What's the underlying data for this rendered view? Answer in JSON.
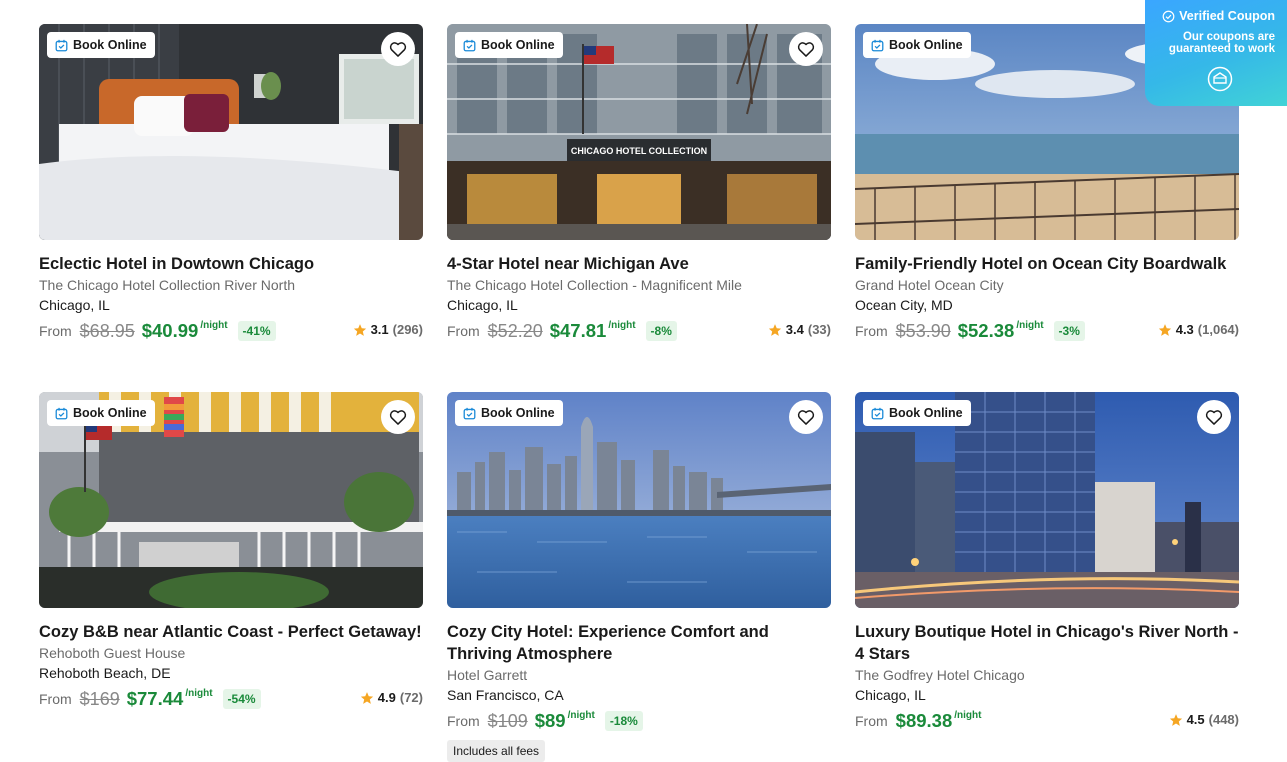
{
  "coupon": {
    "title": "Verified Coupon",
    "subtitle_line1": "Our coupons are",
    "subtitle_line2": "guaranteed to work"
  },
  "labels": {
    "book_online": "Book Online",
    "from": "From",
    "per_night": "/night",
    "includes_fees": "Includes all fees"
  },
  "colors": {
    "price_green": "#1a8a3a",
    "discount_bg": "#e5f5e8",
    "star": "#f5a623",
    "coupon_gradient_start": "#3aa6ff"
  },
  "listings": [
    {
      "title": "Eclectic Hotel in Dowtown Chicago",
      "hotel": "The Chicago Hotel Collection River North",
      "city": "Chicago, IL",
      "old_price": "$68.95",
      "new_price": "$40.99",
      "discount": "-41%",
      "rating": "3.1",
      "reviews": "(296)",
      "image_icon": "hotel-bedroom-image"
    },
    {
      "title": "4-Star Hotel near Michigan Ave",
      "hotel": "The Chicago Hotel Collection - Magnificent Mile",
      "city": "Chicago, IL",
      "old_price": "$52.20",
      "new_price": "$47.81",
      "discount": "-8%",
      "rating": "3.4",
      "reviews": "(33)",
      "image_icon": "hotel-facade-image",
      "sign": "CHICAGO HOTEL COLLECTION"
    },
    {
      "title": "Family-Friendly Hotel on Ocean City Boardwalk",
      "hotel": "Grand Hotel Ocean City",
      "city": "Ocean City, MD",
      "old_price": "$53.90",
      "new_price": "$52.38",
      "discount": "-3%",
      "rating": "4.3",
      "reviews": "(1,064)",
      "image_icon": "ocean-view-image"
    },
    {
      "title": "Cozy B&B near Atlantic Coast - Perfect Getaway!",
      "hotel": "Rehoboth Guest House",
      "city": "Rehoboth Beach, DE",
      "old_price": "$169",
      "new_price": "$77.44",
      "discount": "-54%",
      "rating": "4.9",
      "reviews": "(72)",
      "image_icon": "porch-house-image"
    },
    {
      "title": "Cozy City Hotel: Experience Comfort and Thriving Atmosphere",
      "hotel": "Hotel Garrett",
      "city": "San Francisco, CA",
      "old_price": "$109",
      "new_price": "$89",
      "discount": "-18%",
      "image_icon": "city-skyline-image"
    },
    {
      "title": "Luxury Boutique Hotel in Chicago's River North - 4 Stars",
      "hotel": "The Godfrey Hotel Chicago",
      "city": "Chicago, IL",
      "new_price": "$89.38",
      "rating": "4.5",
      "reviews": "(448)",
      "image_icon": "city-hotel-night-image"
    }
  ]
}
